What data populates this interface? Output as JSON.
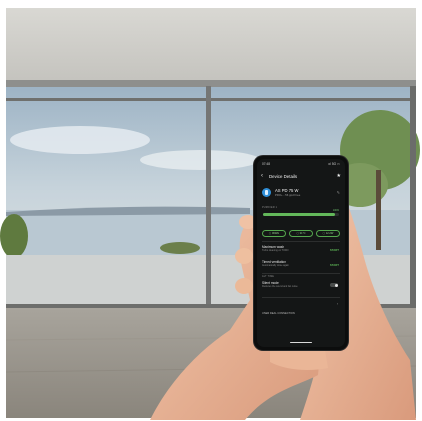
{
  "phone": {
    "status_time": "07:48",
    "status_right": "•ıl 5G ▭",
    "back_icon": "chevron-left-icon",
    "title": "Device Details",
    "favorite_icon": "star-icon",
    "device_name": "AS PD 75 W",
    "device_sub": "PRO+ - 56 ppd Free",
    "edit_icon": "pencil-icon",
    "section_label": "PURIFIER 1",
    "filter_value": "100%",
    "filter_level": 0.95,
    "pills": [
      "▢ 96WH",
      "▢ 31°C",
      "▢ 12.2W"
    ],
    "rows": [
      {
        "title": "Maximum wash",
        "sub": "Turbo cleaning on TODO",
        "action": "START"
      },
      {
        "title": "Timed ventilation",
        "sub": "Automatically close again",
        "action": "START"
      }
    ],
    "mode_section": "ALT TIME",
    "silent_title": "Silent mode",
    "silent_sub": "Reduces the sound and fan noise",
    "silent_on": false,
    "more_label": "USER DEAL CONNECTION",
    "more_icon": "chevron-right-icon"
  },
  "colors": {
    "accent_green": "#63b85a",
    "screen_bg": "#141616",
    "device_blue": "#2f8fd8"
  }
}
